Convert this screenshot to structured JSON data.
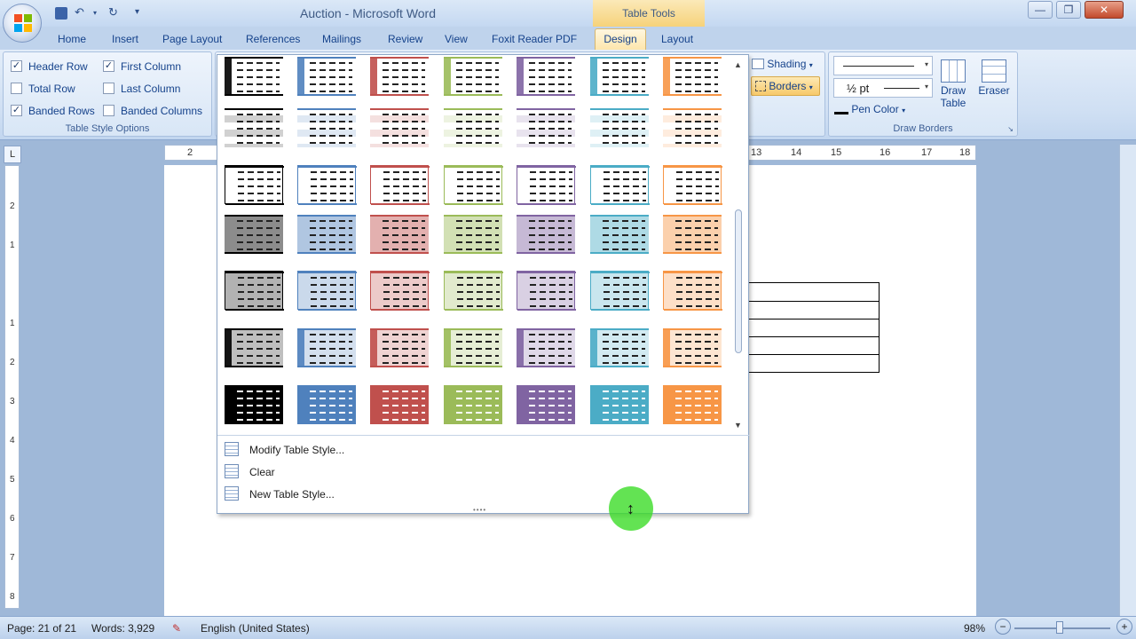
{
  "window": {
    "title": "Auction - Microsoft Word",
    "context_tab": "Table Tools",
    "minimize": "—",
    "maximize": "❐",
    "close": "✕"
  },
  "qat": {
    "undo": "↶",
    "redo": "↻",
    "customize": "▾"
  },
  "tabs": [
    "Home",
    "Insert",
    "Page Layout",
    "References",
    "Mailings",
    "Review",
    "View",
    "Foxit Reader PDF",
    "Design",
    "Layout"
  ],
  "help": "?",
  "table_style_options": {
    "label": "Table Style Options",
    "header_row": {
      "label": "Header Row",
      "checked": true
    },
    "first_column": {
      "label": "First Column",
      "checked": true
    },
    "total_row": {
      "label": "Total Row",
      "checked": false
    },
    "last_column": {
      "label": "Last Column",
      "checked": false
    },
    "banded_rows": {
      "label": "Banded Rows",
      "checked": true
    },
    "banded_columns": {
      "label": "Banded Columns",
      "checked": false
    }
  },
  "table_styles": {
    "shading": "Shading",
    "borders": "Borders"
  },
  "draw_borders": {
    "label": "Draw Borders",
    "line_weight": "½ pt",
    "pen_color": "Pen Color",
    "draw_table": "Draw Table",
    "eraser": "Eraser"
  },
  "ruler": {
    "corner": "L",
    "left_marks": [
      "2",
      "1"
    ],
    "right_marks": [
      "13",
      "14",
      "15",
      "16",
      "17",
      "18"
    ]
  },
  "gallery": {
    "color_columns": [
      "#000000",
      "#4f81bd",
      "#c0504d",
      "#9bbb59",
      "#8064a2",
      "#4bacc6",
      "#f79646"
    ],
    "menu": [
      {
        "label": "Modify Table Style..."
      },
      {
        "label": "Clear"
      },
      {
        "label": "New Table Style..."
      }
    ],
    "grip": "••••"
  },
  "status": {
    "page": "Page: 21 of 21",
    "words": "Words: 3,929",
    "language": "English (United States)",
    "zoom": "98%",
    "zoom_minus": "−",
    "zoom_plus": "+"
  }
}
